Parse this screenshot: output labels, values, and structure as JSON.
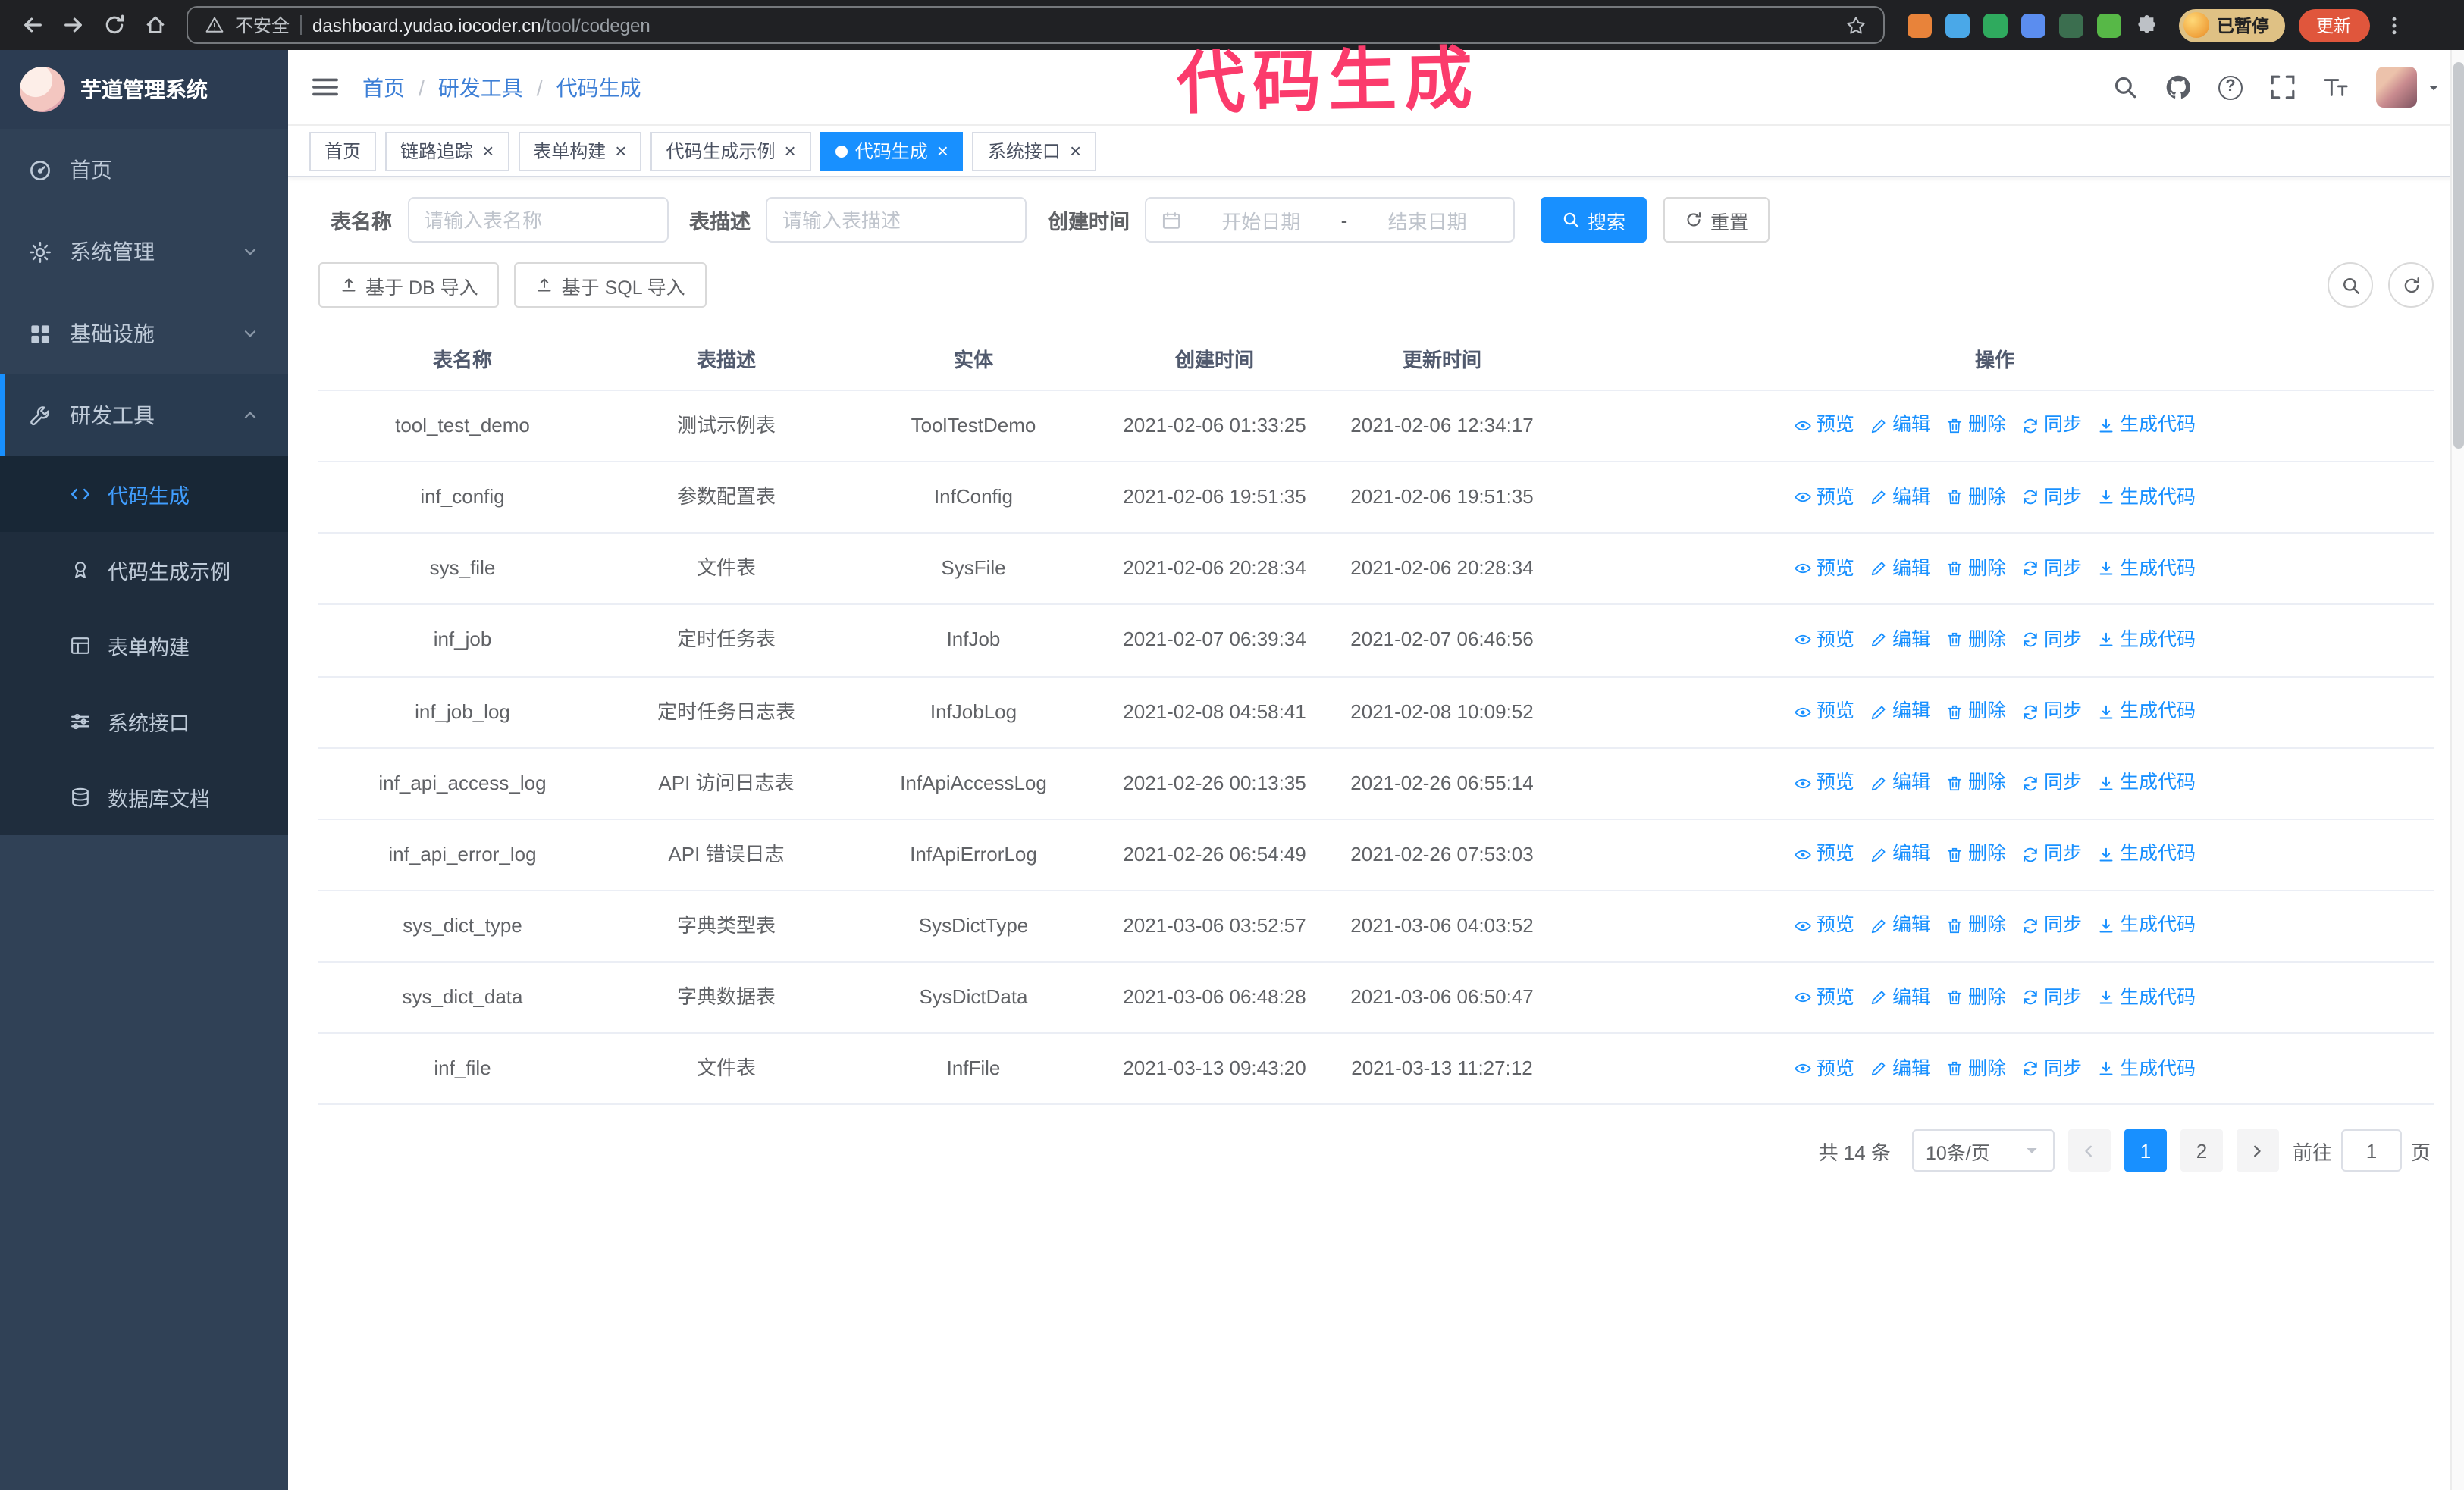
{
  "theme": {
    "accent": "#1890ff",
    "sidebar_bg": "#304156",
    "submenu_bg": "#1f2d3d",
    "sidebar_active": "#409eff",
    "breadcrumb_link": "#3d7fd6",
    "annotation": "#fb3b6c"
  },
  "overlay": {
    "title": "代码生成"
  },
  "browser": {
    "security_label": "不安全",
    "url_host": "dashboard.yudao.iocoder.cn",
    "url_path": "/tool/codegen",
    "profile_badge": "已暂停",
    "update_label": "更新",
    "extensions": [
      {
        "id": "fox",
        "color": "#e8833a"
      },
      {
        "id": "drop",
        "color": "#4aa8e8"
      },
      {
        "id": "check-green",
        "color": "#2faa5e"
      },
      {
        "id": "people",
        "color": "#5b8def"
      },
      {
        "id": "terminal",
        "color": "#3b6e4f"
      },
      {
        "id": "leaf",
        "color": "#57b847"
      },
      {
        "id": "puzzle",
        "color": ""
      }
    ]
  },
  "sidebar": {
    "logo_title": "芋道管理系统",
    "items": [
      {
        "id": "home",
        "label": "首页",
        "icon": "dashboard"
      },
      {
        "id": "system",
        "label": "系统管理",
        "icon": "gear",
        "chevron": "down"
      },
      {
        "id": "infra",
        "label": "基础设施",
        "icon": "grid",
        "chevron": "down"
      },
      {
        "id": "devtools",
        "label": "研发工具",
        "icon": "wrench",
        "chevron": "up",
        "open": true
      }
    ],
    "subitems": [
      {
        "id": "codegen",
        "label": "代码生成",
        "icon": "code",
        "active": true
      },
      {
        "id": "codegen-example",
        "label": "代码生成示例",
        "icon": "badge"
      },
      {
        "id": "form-builder",
        "label": "表单构建",
        "icon": "form"
      },
      {
        "id": "system-api",
        "label": "系统接口",
        "icon": "sliders"
      },
      {
        "id": "db-doc",
        "label": "数据库文档",
        "icon": "database"
      }
    ]
  },
  "header": {
    "breadcrumb": [
      "首页",
      "研发工具",
      "代码生成"
    ],
    "icons": [
      {
        "id": "search"
      },
      {
        "id": "github"
      },
      {
        "id": "question"
      },
      {
        "id": "fullscreen"
      },
      {
        "id": "fontsize"
      }
    ]
  },
  "tabs": [
    {
      "id": "home",
      "label": "首页",
      "closable": false
    },
    {
      "id": "tracer",
      "label": "链路追踪",
      "closable": true
    },
    {
      "id": "form-builder",
      "label": "表单构建",
      "closable": true
    },
    {
      "id": "codegen-example",
      "label": "代码生成示例",
      "closable": true
    },
    {
      "id": "codegen",
      "label": "代码生成",
      "closable": true,
      "active": true
    },
    {
      "id": "system-api",
      "label": "系统接口",
      "closable": true
    }
  ],
  "filters": {
    "table_name_label": "表名称",
    "table_name_placeholder": "请输入表名称",
    "table_desc_label": "表描述",
    "table_desc_placeholder": "请输入表描述",
    "create_time_label": "创建时间",
    "date_start_placeholder": "开始日期",
    "date_separator": "-",
    "date_end_placeholder": "结束日期",
    "search_label": "搜索",
    "reset_label": "重置"
  },
  "toolbar": {
    "import_db_label": "基于 DB 导入",
    "import_sql_label": "基于 SQL 导入"
  },
  "table": {
    "columns": [
      "表名称",
      "表描述",
      "实体",
      "创建时间",
      "更新时间",
      "操作"
    ],
    "row_actions": [
      {
        "id": "preview",
        "label": "预览",
        "icon": "eye"
      },
      {
        "id": "edit",
        "label": "编辑",
        "icon": "pencil"
      },
      {
        "id": "delete",
        "label": "删除",
        "icon": "trash"
      },
      {
        "id": "sync",
        "label": "同步",
        "icon": "sync"
      },
      {
        "id": "generate-code",
        "label": "生成代码",
        "icon": "download"
      }
    ],
    "rows": [
      {
        "name": "tool_test_demo",
        "desc": "测试示例表",
        "entity": "ToolTestDemo",
        "created": "2021-02-06 01:33:25",
        "updated": "2021-02-06 12:34:17"
      },
      {
        "name": "inf_config",
        "desc": "参数配置表",
        "entity": "InfConfig",
        "created": "2021-02-06 19:51:35",
        "updated": "2021-02-06 19:51:35"
      },
      {
        "name": "sys_file",
        "desc": "文件表",
        "entity": "SysFile",
        "created": "2021-02-06 20:28:34",
        "updated": "2021-02-06 20:28:34"
      },
      {
        "name": "inf_job",
        "desc": "定时任务表",
        "entity": "InfJob",
        "created": "2021-02-07 06:39:34",
        "updated": "2021-02-07 06:46:56"
      },
      {
        "name": "inf_job_log",
        "desc": "定时任务日志表",
        "entity": "InfJobLog",
        "created": "2021-02-08 04:58:41",
        "updated": "2021-02-08 10:09:52"
      },
      {
        "name": "inf_api_access_log",
        "desc": "API 访问日志表",
        "entity": "InfApiAccessLog",
        "created": "2021-02-26 00:13:35",
        "updated": "2021-02-26 06:55:14"
      },
      {
        "name": "inf_api_error_log",
        "desc": "API 错误日志",
        "entity": "InfApiErrorLog",
        "created": "2021-02-26 06:54:49",
        "updated": "2021-02-26 07:53:03"
      },
      {
        "name": "sys_dict_type",
        "desc": "字典类型表",
        "entity": "SysDictType",
        "created": "2021-03-06 03:52:57",
        "updated": "2021-03-06 04:03:52"
      },
      {
        "name": "sys_dict_data",
        "desc": "字典数据表",
        "entity": "SysDictData",
        "created": "2021-03-06 06:48:28",
        "updated": "2021-03-06 06:50:47"
      },
      {
        "name": "inf_file",
        "desc": "文件表",
        "entity": "InfFile",
        "created": "2021-03-13 09:43:20",
        "updated": "2021-03-13 11:27:12"
      }
    ]
  },
  "pagination": {
    "total_text": "共 14 条",
    "page_size": "10条/页",
    "pages": [
      "1",
      "2"
    ],
    "active_page": "1",
    "goto_label": "前往",
    "goto_value": "1",
    "goto_unit": "页"
  }
}
